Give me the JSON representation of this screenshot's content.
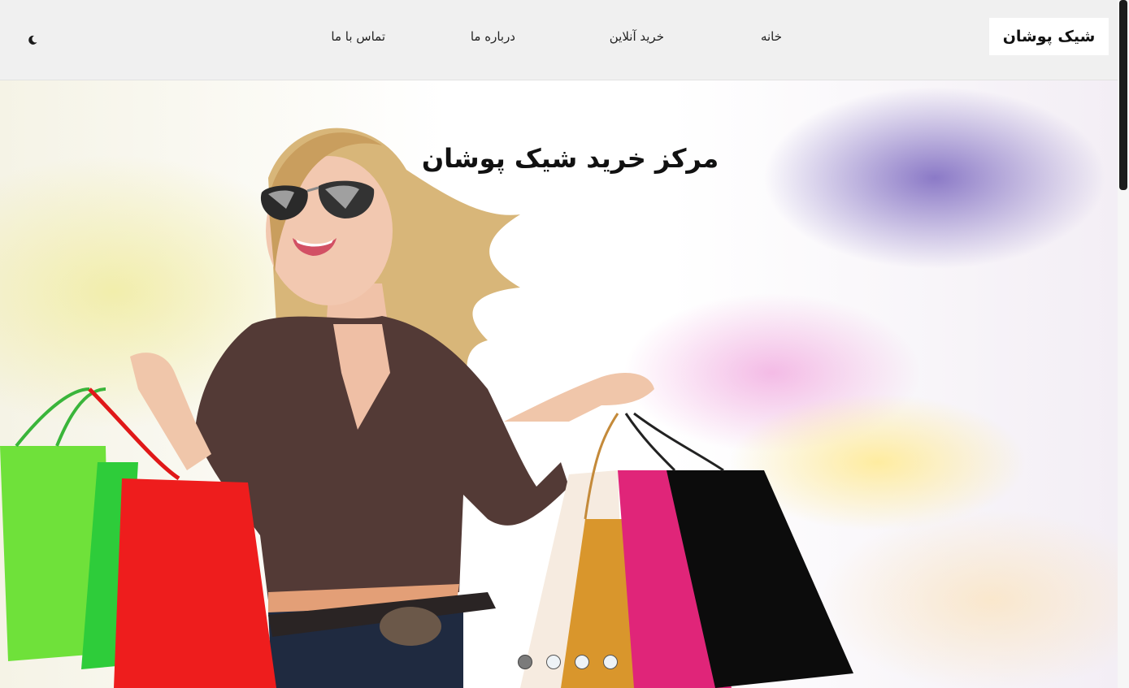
{
  "nav": {
    "brand": "شیک پوشان",
    "links": [
      {
        "label": "خانه"
      },
      {
        "label": "خرید آنلاین"
      },
      {
        "label": "درباره ما"
      },
      {
        "label": "تماس با ما"
      }
    ],
    "theme_toggle_icon": "moon-icon"
  },
  "hero": {
    "title": "مرکز خرید شیک پوشان",
    "image_icon": "shopping-woman-photo",
    "slides": [
      {
        "active": true
      },
      {
        "active": false
      },
      {
        "active": false
      },
      {
        "active": false
      }
    ]
  },
  "colors": {
    "navbar_bg": "#f0f0f0",
    "brand_bg": "#ffffff",
    "text": "#111111",
    "dot_active": "#7b7b7b",
    "dot_inactive": "#eef3f7"
  }
}
